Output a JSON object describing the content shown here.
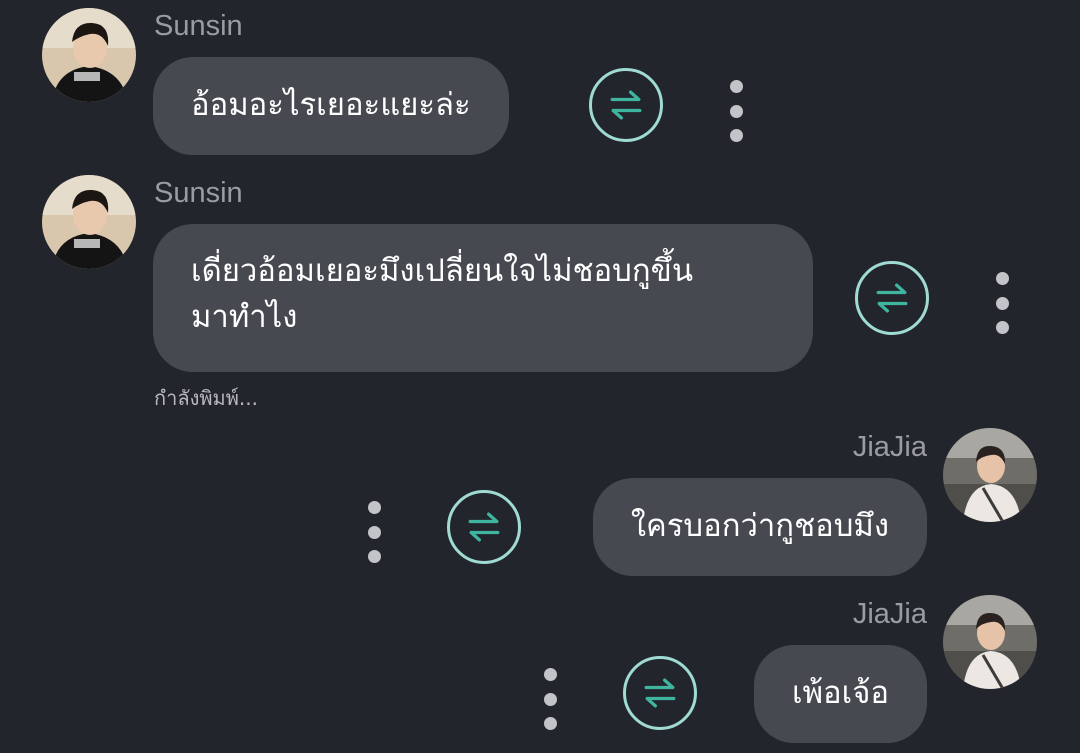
{
  "colors": {
    "background": "#23252d",
    "bubble": "#474951",
    "translate_accent": "#3fb59f"
  },
  "icons": {
    "translate": "swap-arrows-icon",
    "more": "vertical-dots-icon"
  },
  "messages": [
    {
      "sender": "Sunsin",
      "side": "left",
      "text": "อ้อมอะไรเยอะแยะล่ะ"
    },
    {
      "sender": "Sunsin",
      "side": "left",
      "lines": [
        "เดี่ยวอ้อมเยอะมึงเปลี่ยนใจไม่ชอบกูขึ้น",
        "มาทำไง"
      ]
    },
    {
      "sender": "JiaJia",
      "side": "right",
      "text": "ใครบอกว่ากูชอบมึง"
    },
    {
      "sender": "JiaJia",
      "side": "right",
      "text": "เพ้อเจ้อ"
    }
  ],
  "typing_indicator": "กำลังพิมพ์..."
}
